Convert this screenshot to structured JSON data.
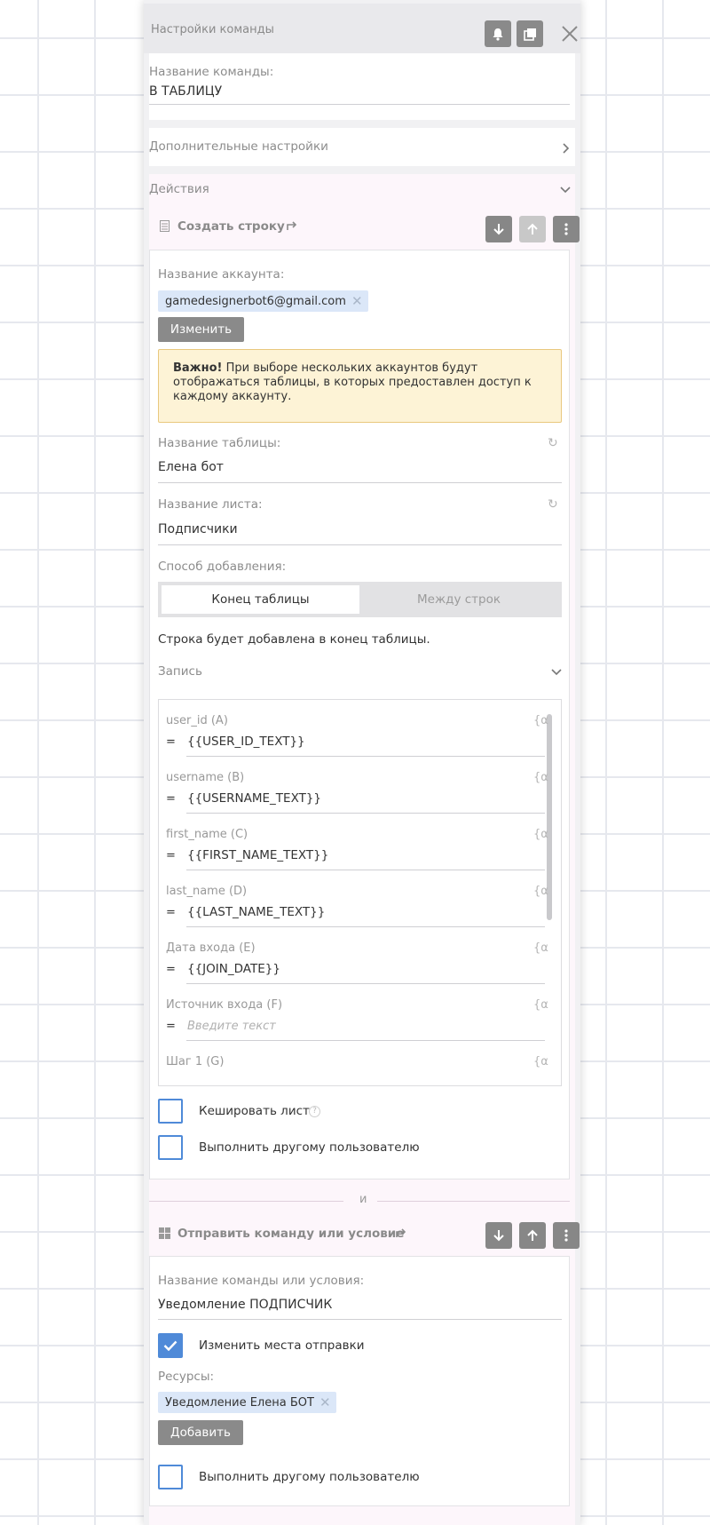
{
  "header": {
    "title": "Настройки команды"
  },
  "command": {
    "name_label": "Название команды:",
    "name_value": "В ТАБЛИЦУ"
  },
  "extra_settings": {
    "label": "Дополнительные настройки"
  },
  "actions": {
    "label": "Действия",
    "and_separator": "и",
    "create_row": {
      "title": "Создать строку",
      "account_label": "Название аккаунта:",
      "account_chip": "gamedesignerbot6@gmail.com",
      "change_button": "Изменить",
      "warning_bold": "Важно!",
      "warning_text": " При выборе нескольких аккаунтов будут отображаться таблицы, в которых предоставлен доступ к каждому аккаунту.",
      "table_label": "Название таблицы:",
      "table_value": "Елена бот",
      "sheet_label": "Название листа:",
      "sheet_value": "Подписчики",
      "method_label": "Способ добавления:",
      "method_options": [
        "Конец таблицы",
        "Между строк"
      ],
      "method_selected": "Конец таблицы",
      "method_note": "Строка будет добавлена в конец таблицы.",
      "record_label": "Запись",
      "fields": [
        {
          "label": "user_id (A)",
          "eq": "=",
          "value": "{{USER_ID_TEXT}}",
          "var": "{α"
        },
        {
          "label": "username (B)",
          "eq": "=",
          "value": "{{USERNAME_TEXT}}",
          "var": "{α"
        },
        {
          "label": "first_name (C)",
          "eq": "=",
          "value": "{{FIRST_NAME_TEXT}}",
          "var": "{α"
        },
        {
          "label": "last_name (D)",
          "eq": "=",
          "value": "{{LAST_NAME_TEXT}}",
          "var": "{α"
        },
        {
          "label": "Дата входа (E)",
          "eq": "=",
          "value": "{{JOIN_DATE}}",
          "var": "{α"
        },
        {
          "label": "Источник входа (F)",
          "eq": "=",
          "placeholder": "Введите текст",
          "var": "{α"
        },
        {
          "label": "Шаг 1 (G)",
          "var": "{α"
        }
      ],
      "cache_sheet": {
        "label": "Кешировать лист",
        "help": "?",
        "checked": false
      },
      "run_other_user": {
        "label": "Выполнить другому пользователю",
        "checked": false
      }
    },
    "send_command": {
      "title": "Отправить команду или условие",
      "name_label": "Название команды или условия:",
      "name_value": "Уведомление ПОДПИСЧИК",
      "change_destinations": {
        "label": "Изменить места отправки",
        "checked": true
      },
      "resources_label": "Ресурсы:",
      "resource_chip": "Уведомление Елена БОТ",
      "add_button": "Добавить",
      "run_other_user": {
        "label": "Выполнить другому пользователю",
        "checked": false
      }
    }
  },
  "icons": {
    "bell": "bell-icon",
    "copy": "copy-icon",
    "close": "close-icon",
    "chevron_right": "chevron-right-icon",
    "chevron_down": "chevron-down-icon",
    "arrow_down": "arrow-down-icon",
    "arrow_up": "arrow-up-icon",
    "more": "more-vertical-icon",
    "sheet": "sheet-icon",
    "redirect": "redirect-icon",
    "refresh": "refresh-icon",
    "grid": "grid-icon",
    "check": "check-icon",
    "remove": "remove-chip-icon"
  },
  "colors": {
    "accent": "#4f8ad8",
    "chip": "#dbe7f8",
    "warning_bg": "#fdf3d6",
    "warning_border": "#e9c87e",
    "actions_bg": "#fdf6fb",
    "button_gray": "#8a8a8a"
  }
}
